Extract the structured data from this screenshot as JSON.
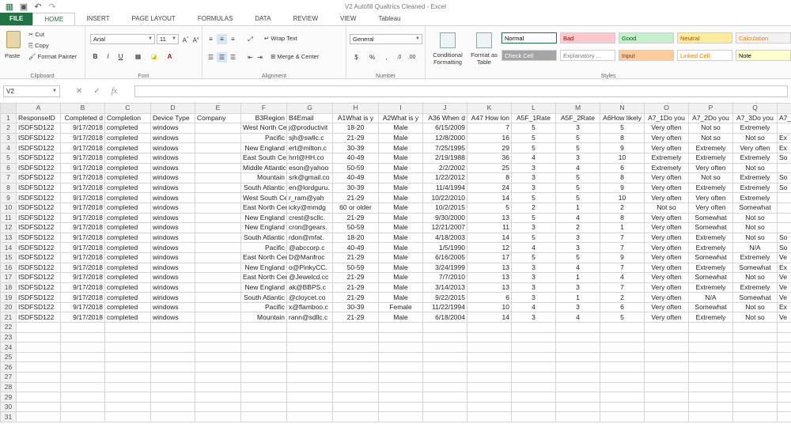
{
  "window": {
    "title": "V2 Autofill Qualtrics Cleaned - Excel"
  },
  "tabs": [
    "FILE",
    "HOME",
    "INSERT",
    "PAGE LAYOUT",
    "FORMULAS",
    "DATA",
    "REVIEW",
    "VIEW",
    "Tableau"
  ],
  "ribbon": {
    "clipboard": {
      "paste": "Paste",
      "cut": "Cut",
      "copy": "Copy",
      "format_painter": "Format Painter",
      "label": "Clipboard"
    },
    "font": {
      "name": "Arial",
      "size": "11",
      "bold": "B",
      "italic": "I",
      "underline": "U",
      "label": "Font"
    },
    "alignment": {
      "wrap": "Wrap Text",
      "merge": "Merge & Center",
      "label": "Alignment"
    },
    "number": {
      "format": "General",
      "currency": "$",
      "percent": "%",
      "comma": ",",
      "label": "Number"
    },
    "conditional": "Conditional Formatting",
    "format_table": "Format as Table",
    "styles": {
      "label": "Styles",
      "cells": [
        {
          "name": "Normal",
          "bg": "#ffffff",
          "fg": "#000000"
        },
        {
          "name": "Bad",
          "bg": "#ffc7ce",
          "fg": "#9c0006"
        },
        {
          "name": "Good",
          "bg": "#c6efce",
          "fg": "#006100"
        },
        {
          "name": "Neutral",
          "bg": "#ffeb9c",
          "fg": "#9c5700"
        },
        {
          "name": "Calculation",
          "bg": "#f2f2f2",
          "fg": "#fa7d00"
        },
        {
          "name": "Check Cell",
          "bg": "#a5a5a5",
          "fg": "#ffffff"
        },
        {
          "name": "Explanatory ...",
          "bg": "#ffffff",
          "fg": "#7f7f7f"
        },
        {
          "name": "Input",
          "bg": "#ffcc99",
          "fg": "#3f3f76"
        },
        {
          "name": "Linked Cell",
          "bg": "#ffffff",
          "fg": "#fa7d00"
        },
        {
          "name": "Note",
          "bg": "#ffffcc",
          "fg": "#000000"
        }
      ]
    }
  },
  "formula_bar": {
    "name_box": "V2",
    "fx": "fx",
    "value": ""
  },
  "grid": {
    "columns": [
      "A",
      "B",
      "C",
      "D",
      "E",
      "F",
      "G",
      "H",
      "I",
      "J",
      "K",
      "L",
      "M",
      "N",
      "O",
      "P",
      "Q",
      "R"
    ],
    "header_row": [
      "ResponseID",
      "Completed d",
      "Completion",
      "Device Type",
      "Company",
      "B3Region",
      "B4Email",
      "A1What is y",
      "A2What is y",
      "A36 When d",
      "A47 How lon",
      "A5F_1Rate",
      "A5F_2Rate",
      "A6How likely",
      "A7_1Do you",
      "A7_2Do you",
      "A7_3Do you",
      "A7_"
    ],
    "rows": [
      [
        "ISDFSD122",
        "9/17/2018",
        "completed",
        "windows",
        "",
        "West North Cen",
        "j@productivit",
        "18-20",
        "Male",
        "6/15/2009",
        "7",
        "5",
        "3",
        "5",
        "Very often",
        "Not so",
        "Extremely",
        ""
      ],
      [
        "ISDFSD122",
        "9/17/2018",
        "completed",
        "windows",
        "",
        "Pacific",
        "sjh@swllc.c",
        "21-29",
        "Male",
        "12/8/2000",
        "16",
        "5",
        "5",
        "8",
        "Very often",
        "Not so",
        "Not so",
        "Ex"
      ],
      [
        "ISDFSD122",
        "9/17/2018",
        "completed",
        "windows",
        "",
        "New England",
        "ert@milton.c",
        "30-39",
        "Male",
        "7/25/1995",
        "29",
        "5",
        "5",
        "9",
        "Very often",
        "Extremely",
        "Very often",
        "Ex"
      ],
      [
        "ISDFSD122",
        "9/17/2018",
        "completed",
        "windows",
        "",
        "East South Cen",
        "hrrl@HH.co",
        "40-49",
        "Male",
        "2/19/1988",
        "36",
        "4",
        "3",
        "10",
        "Extremely",
        "Extremely",
        "Extremely",
        "So"
      ],
      [
        "ISDFSD122",
        "9/17/2018",
        "completed",
        "windows",
        "",
        "Middle Atlantic",
        "eson@yahoo",
        "50-59",
        "Male",
        "2/2/2002",
        "25",
        "3",
        "4",
        "6",
        "Extremely",
        "Very often",
        "Not so",
        ""
      ],
      [
        "ISDFSD122",
        "9/17/2018",
        "completed",
        "windows",
        "",
        "Mountain",
        "srk@gmail.co",
        "40-49",
        "Male",
        "1/22/2012",
        "8",
        "3",
        "5",
        "8",
        "Very often",
        "Not so",
        "Extremely",
        "So"
      ],
      [
        "ISDFSD122",
        "9/17/2018",
        "completed",
        "windows",
        "",
        "South Atlantic",
        "en@lordguru.",
        "30-39",
        "Male",
        "11/4/1994",
        "24",
        "3",
        "5",
        "9",
        "Very often",
        "Extremely",
        "Extremely",
        "So"
      ],
      [
        "ISDFSD122",
        "9/17/2018",
        "completed",
        "windows",
        "",
        "West South Cen",
        "r_ram@yah",
        "21-29",
        "Male",
        "10/22/2010",
        "14",
        "5",
        "5",
        "10",
        "Very often",
        "Very often",
        "Extremely",
        ""
      ],
      [
        "ISDFSD122",
        "9/17/2018",
        "completed",
        "windows",
        "",
        "East North Cen",
        "icky@mmdg",
        "60 or older",
        "Male",
        "10/2/2015",
        "5",
        "2",
        "1",
        "2",
        "Not so",
        "Very often",
        "Somewhat",
        ""
      ],
      [
        "ISDFSD122",
        "9/17/2018",
        "completed",
        "windows",
        "",
        "New England",
        "crest@scllc.",
        "21-29",
        "Male",
        "9/30/2000",
        "13",
        "5",
        "4",
        "8",
        "Very often",
        "Somewhat",
        "Not so",
        ""
      ],
      [
        "ISDFSD122",
        "9/17/2018",
        "completed",
        "windows",
        "",
        "New England",
        "cron@gears.",
        "50-59",
        "Male",
        "12/21/2007",
        "11",
        "3",
        "2",
        "1",
        "Very often",
        "Somewhat",
        "Not so",
        ""
      ],
      [
        "ISDFSD122",
        "9/17/2018",
        "completed",
        "windows",
        "",
        "South Atlantic",
        "rdon@mfat.",
        "18-20",
        "Male",
        "4/18/2003",
        "14",
        "5",
        "3",
        "7",
        "Very often",
        "Extremely",
        "Not so",
        "So"
      ],
      [
        "ISDFSD122",
        "9/17/2018",
        "completed",
        "windows",
        "",
        "Pacific",
        "@abccorp.c",
        "40-49",
        "Male",
        "1/5/1990",
        "12",
        "4",
        "3",
        "7",
        "Very often",
        "Extremely",
        "N/A",
        "So"
      ],
      [
        "ISDFSD122",
        "9/17/2018",
        "completed",
        "windows",
        "",
        "East North Cen",
        "D@Manfroc",
        "21-29",
        "Male",
        "6/16/2005",
        "17",
        "5",
        "5",
        "9",
        "Very often",
        "Somewhat",
        "Extremely",
        "Ve"
      ],
      [
        "ISDFSD122",
        "9/17/2018",
        "completed",
        "windows",
        "",
        "New England",
        "o@PinkyCC.",
        "50-59",
        "Male",
        "3/24/1999",
        "13",
        "3",
        "4",
        "7",
        "Very often",
        "Extremely",
        "Somewhat",
        "Ex"
      ],
      [
        "ISDFSD122",
        "9/17/2018",
        "completed",
        "windows",
        "",
        "East North Cen",
        "@Jewelcd.cc",
        "21-29",
        "Male",
        "7/7/2010",
        "13",
        "3",
        "1",
        "4",
        "Very often",
        "Somewhat",
        "Not so",
        "Ve"
      ],
      [
        "ISDFSD122",
        "9/17/2018",
        "completed",
        "windows",
        "",
        "New England",
        "ak@BBPS.c",
        "21-29",
        "Male",
        "3/14/2013",
        "13",
        "3",
        "3",
        "7",
        "Very often",
        "Extremely",
        "Extremely",
        "Ve"
      ],
      [
        "ISDFSD122",
        "9/17/2018",
        "completed",
        "windows",
        "",
        "South Atlantic",
        "@cloycet.co",
        "21-29",
        "Male",
        "9/22/2015",
        "6",
        "3",
        "1",
        "2",
        "Very often",
        "N/A",
        "Somewhat",
        "Ve"
      ],
      [
        "ISDFSD122",
        "9/17/2018",
        "completed",
        "windows",
        "",
        "Pacific",
        "x@flamboo.c",
        "30-39",
        "Female",
        "11/22/1994",
        "10",
        "4",
        "3",
        "6",
        "Very often",
        "Somewhat",
        "Not so",
        "Ex"
      ],
      [
        "ISDFSD122",
        "9/17/2018",
        "completed",
        "windows",
        "",
        "Mountain",
        "rann@sdllc.c",
        "21-29",
        "Male",
        "6/18/2004",
        "14",
        "3",
        "4",
        "5",
        "Very often",
        "Extremely",
        "Not so",
        "Ve"
      ]
    ],
    "empty_rows": 10
  }
}
